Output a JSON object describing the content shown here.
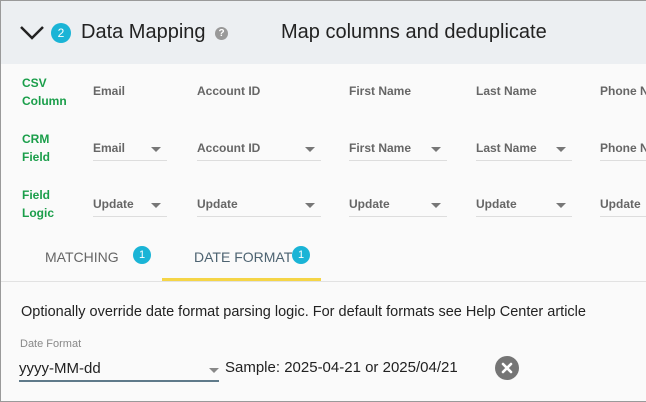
{
  "header": {
    "step": "2",
    "title": "Data Mapping",
    "subtitle": "Map columns and deduplicate",
    "icons": {
      "collapse": "chevron-down-icon",
      "help": "help-circle-icon"
    }
  },
  "rows": {
    "csv": "CSV\nColumn",
    "crm": "CRM\nField",
    "logic": "Field\nLogic"
  },
  "columns": [
    {
      "csv": "Email",
      "crm": "Email",
      "logic": "Update"
    },
    {
      "csv": "Account ID",
      "crm": "Account ID",
      "logic": "Update"
    },
    {
      "csv": "First Name",
      "crm": "First Name",
      "logic": "Update"
    },
    {
      "csv": "Last Name",
      "crm": "Last Name",
      "logic": "Update"
    },
    {
      "csv": "Phone N",
      "crm": "Phone N",
      "logic": "Update"
    }
  ],
  "tabs": [
    {
      "label": "MATCHING",
      "count": "1"
    },
    {
      "label": "DATE FORMAT",
      "count": "1",
      "active": true
    }
  ],
  "date_format": {
    "description": "Optionally override date format parsing logic. For default formats see Help Center article",
    "label": "Date Format",
    "value": "yyyy-MM-dd",
    "sample": "Sample: 2025-04-21 or 2025/04/21"
  },
  "colors": {
    "accent": "#1ab4d6",
    "label_green": "#1a9e4a",
    "tab_underline": "#f5d547"
  }
}
